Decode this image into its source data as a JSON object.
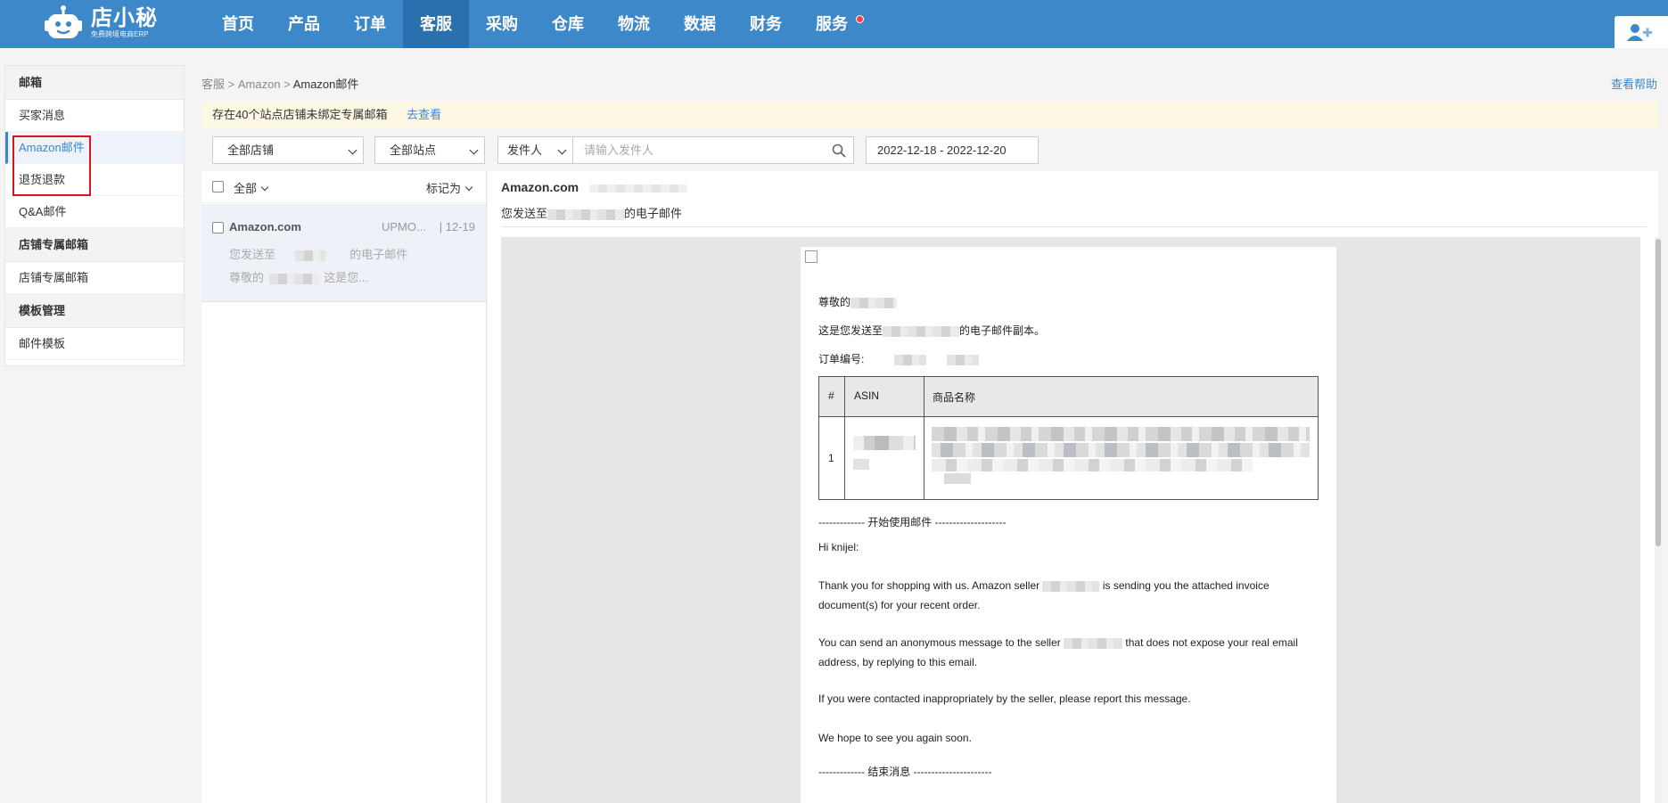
{
  "brand": {
    "name": "店小秘",
    "tagline": "免费跨境电商ERP"
  },
  "nav": {
    "items": [
      {
        "label": "首页",
        "active": false
      },
      {
        "label": "产品",
        "active": false
      },
      {
        "label": "订单",
        "active": false
      },
      {
        "label": "客服",
        "active": true
      },
      {
        "label": "采购",
        "active": false
      },
      {
        "label": "仓库",
        "active": false
      },
      {
        "label": "物流",
        "active": false
      },
      {
        "label": "数据",
        "active": false
      },
      {
        "label": "财务",
        "active": false
      },
      {
        "label": "服务",
        "active": false,
        "badge_dot": true
      }
    ]
  },
  "sidebar": {
    "sections": [
      {
        "title": "邮箱",
        "items": [
          "买家消息",
          "Amazon邮件",
          "退货退款",
          "Q&A邮件"
        ]
      },
      {
        "title": "店铺专属邮箱",
        "items": [
          "店铺专属邮箱"
        ]
      },
      {
        "title": "模板管理",
        "items": [
          "邮件模板"
        ]
      }
    ],
    "active_item": "Amazon邮件"
  },
  "breadcrumb": {
    "items": [
      "客服",
      "Amazon",
      "Amazon邮件"
    ],
    "separator": ">"
  },
  "help_link": "查看帮助",
  "notice": {
    "text": "存在40个站点店铺未绑定专属邮箱",
    "link": "去查看"
  },
  "filters": {
    "store": "全部店铺",
    "site": "全部站点",
    "sender_type": "发件人",
    "search_placeholder": "请输入发件人",
    "date_range": "2022-12-18 - 2022-12-20"
  },
  "mail_list": {
    "select_all": "全部",
    "mark_as": "标记为",
    "items": [
      {
        "from": "Amazon.com",
        "to": "UPMO...",
        "date": "| 12-19",
        "line1_a": "您发送至",
        "line1_b": "的电子邮件",
        "line2_a": "尊敬的",
        "line2_b": "这是您..."
      }
    ]
  },
  "detail": {
    "from": "Amazon.com",
    "subject_a": "您发送至",
    "subject_b": "的电子邮件",
    "body": {
      "greeting": "尊敬的",
      "copy_a": "这是您发送至",
      "copy_b": "的电子邮件副本。",
      "order_no": "订单编号:",
      "table": {
        "headers": [
          "#",
          "ASIN",
          "商品名称"
        ],
        "rows": [
          {
            "index": "1"
          }
        ]
      },
      "start_marker": "------------- 开始使用邮件 --------------------",
      "hi": "Hi knijel:",
      "p1_a": "Thank you for shopping with us. Amazon seller",
      "p1_b": "is sending you the attached invoice document(s) for your recent order.",
      "p2_a": "You can send an anonymous message to the seller",
      "p2_b": "that does not expose your real email address, by replying to this email.",
      "p3": "If you were contacted inappropriately by the seller, please report this message.",
      "p4": "We hope to see you again soon.",
      "end_marker": "------------- 结束消息 ----------------------"
    }
  },
  "colors": {
    "nav_bg": "#3d88c9",
    "nav_active": "#2a6fae",
    "accent": "#3d88c9",
    "notice_bg": "#fcf8e3",
    "highlight_box": "#d9141c",
    "badge": "#ff3b3b"
  },
  "icons": [
    "robot-logo-icon",
    "user-icon",
    "search-icon",
    "broken-image-icon",
    "chevron-down-icon"
  ]
}
